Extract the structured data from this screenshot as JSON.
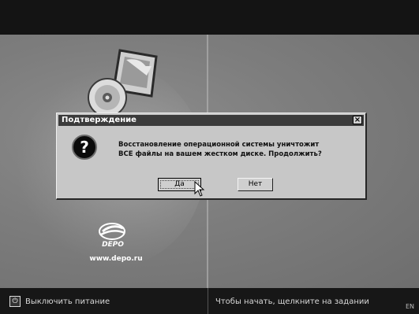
{
  "dialog": {
    "title": "Подтверждение",
    "message_line1": "Восстановление операционной системы уничтожит",
    "message_line2": "ВСЕ файлы на вашем жестком диске. Продолжить?",
    "yes_label": "Да",
    "no_label": "Нет",
    "close_glyph": "×",
    "question_glyph": "?"
  },
  "branding": {
    "logo_text": "DEPO",
    "url": "www.depo.ru"
  },
  "taskbar": {
    "power_label": "Выключить питание",
    "hint": "Чтобы начать, щелкните на задании",
    "language": "EN"
  },
  "colors": {
    "background": "#7d7d7d",
    "dialog_face": "#c7c7c7",
    "titlebar": "#3b3b3b",
    "taskbar": "#171717"
  }
}
